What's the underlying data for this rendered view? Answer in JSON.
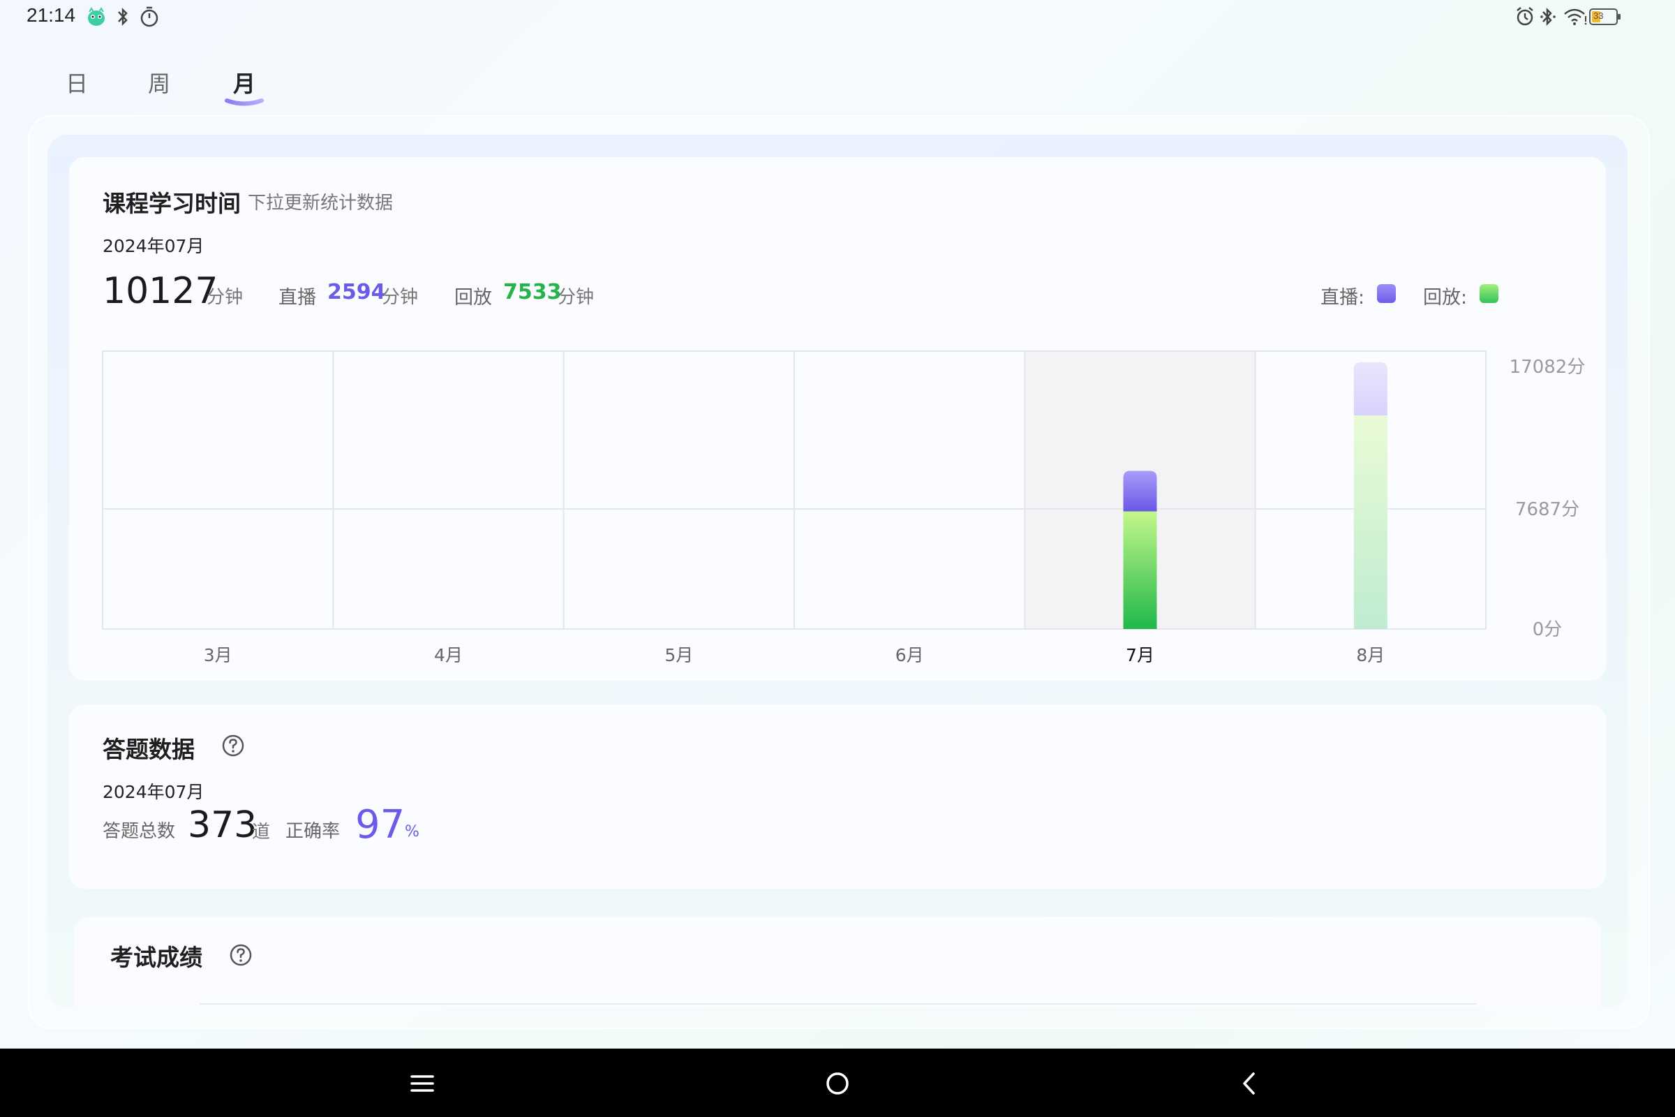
{
  "status_bar": {
    "time": "21:14",
    "battery_level": "33",
    "left_icons": [
      "app-mascot-icon",
      "bluetooth-icon",
      "timer-icon"
    ],
    "right_icons": [
      "alarm-icon",
      "bluetooth-icon",
      "wifi-icon",
      "battery-icon"
    ]
  },
  "tabs": [
    {
      "label": "日",
      "active": false
    },
    {
      "label": "周",
      "active": false
    },
    {
      "label": "月",
      "active": true
    }
  ],
  "study_time": {
    "title": "课程学习时间",
    "subtitle": "下拉更新统计数据",
    "date": "2024年07月",
    "total": "10127",
    "total_unit": "分钟",
    "live_label": "直播",
    "live_value": "2594",
    "live_unit": "分钟",
    "replay_label": "回放",
    "replay_value": "7533",
    "replay_unit": "分钟",
    "legend_live": "直播:",
    "legend_replay": "回放:"
  },
  "chart_data": {
    "type": "bar",
    "stacked": true,
    "categories": [
      "3月",
      "4月",
      "5月",
      "6月",
      "7月",
      "8月"
    ],
    "selected_category": "7月",
    "series": [
      {
        "name": "直播",
        "color": "#7b6cf0",
        "values": [
          0,
          0,
          0,
          0,
          2594,
          3400
        ]
      },
      {
        "name": "回放",
        "color": "#3ec957",
        "values": [
          0,
          0,
          0,
          0,
          7533,
          13682
        ]
      }
    ],
    "y_ticks": [
      "17082分",
      "7687分",
      "0分"
    ],
    "y_tick_values": [
      17082,
      7687,
      0
    ],
    "ylim": [
      0,
      17082
    ],
    "grid": true
  },
  "quiz": {
    "title": "答题数据",
    "date": "2024年07月",
    "total_label": "答题总数",
    "total_value": "373",
    "total_unit": "道",
    "accuracy_label": "正确率",
    "accuracy_value": "97",
    "accuracy_unit": "%"
  },
  "exam": {
    "title": "考试成绩"
  },
  "nav_bar": {
    "icons": [
      "menu-icon",
      "home-icon",
      "back-icon"
    ]
  }
}
